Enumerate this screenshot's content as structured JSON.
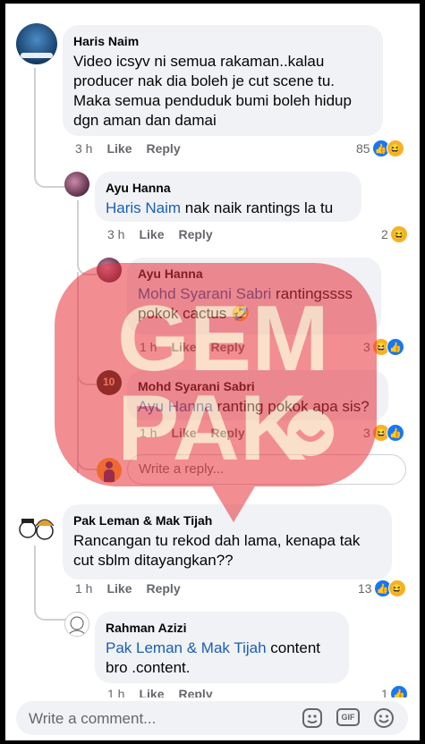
{
  "comments": [
    {
      "name": "Haris Naim",
      "text": "Video icsyv ni semua rakaman..kalau producer nak dia boleh je cut scene tu. Maka semua penduduk bumi boleh hidup dgn aman dan damai",
      "time": "3 h",
      "like": "Like",
      "reply": "Reply",
      "count": "85"
    },
    {
      "name": "Ayu Hanna",
      "mention": "Haris Naim",
      "text": " nak naik rantings la tu",
      "time": "3 h",
      "like": "Like",
      "reply": "Reply",
      "count": "2"
    },
    {
      "name": "Ayu Hanna",
      "mention": "Mohd Syarani Sabri",
      "text": " rantingssss pokok cactus 🤣",
      "time": "1 h",
      "like": "Like",
      "reply": "Reply",
      "count": "3"
    },
    {
      "name": "Mohd Syarani Sabri",
      "mention": "Ayu Hanna",
      "text": " ranting pokok apa sis?",
      "time": "1 h",
      "like": "Like",
      "reply": "Reply",
      "count": "3"
    },
    {
      "name": "Pak Leman & Mak Tijah",
      "text": "Rancangan tu rekod dah lama, kenapa tak cut sblm ditayangkan??",
      "time": "1 h",
      "like": "Like",
      "reply": "Reply",
      "count": "13"
    },
    {
      "name": "Rahman Azizi",
      "mention": "Pak Leman & Mak Tijah",
      "text": " content bro .content.",
      "time": "1 h",
      "like": "Like",
      "reply": "Reply",
      "count": "1"
    }
  ],
  "reply_box": {
    "placeholder": "Write a reply..."
  },
  "comment_box": {
    "placeholder": "Write a comment...",
    "gif_label": "GIF"
  },
  "watermark": {
    "line1": "GEM",
    "line2": "PAK"
  },
  "colors": {
    "accent": "#1877f2",
    "bubble": "#f0f2f5",
    "watermark": "#e8313a"
  },
  "icons": [
    "like-reaction-icon",
    "haha-reaction-icon",
    "sticker-icon",
    "gif-icon",
    "emoji-icon"
  ]
}
